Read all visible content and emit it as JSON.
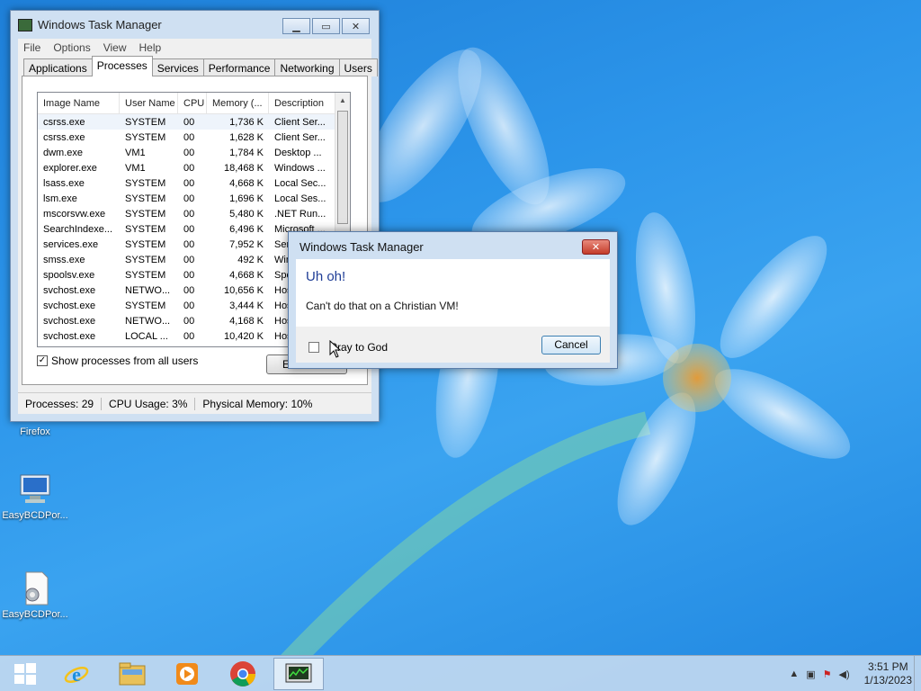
{
  "desktop": {
    "icons": [
      {
        "label": "Firefox"
      },
      {
        "label": "EasyBCDPor..."
      },
      {
        "label": "EasyBCDPor..."
      }
    ]
  },
  "task_manager": {
    "title": "Windows Task Manager",
    "menu": [
      "File",
      "Options",
      "View",
      "Help"
    ],
    "tabs": [
      "Applications",
      "Processes",
      "Services",
      "Performance",
      "Networking",
      "Users"
    ],
    "active_tab": "Processes",
    "columns": [
      "Image Name",
      "User Name",
      "CPU",
      "Memory (...",
      "Description"
    ],
    "rows": [
      [
        "csrss.exe",
        "SYSTEM",
        "00",
        "1,736 K",
        "Client Ser..."
      ],
      [
        "csrss.exe",
        "SYSTEM",
        "00",
        "1,628 K",
        "Client Ser..."
      ],
      [
        "dwm.exe",
        "VM1",
        "00",
        "1,784 K",
        "Desktop ..."
      ],
      [
        "explorer.exe",
        "VM1",
        "00",
        "18,468 K",
        "Windows ..."
      ],
      [
        "lsass.exe",
        "SYSTEM",
        "00",
        "4,668 K",
        "Local Sec..."
      ],
      [
        "lsm.exe",
        "SYSTEM",
        "00",
        "1,696 K",
        "Local Ses..."
      ],
      [
        "mscorsvw.exe",
        "SYSTEM",
        "00",
        "5,480 K",
        ".NET Run..."
      ],
      [
        "SearchIndexe...",
        "SYSTEM",
        "00",
        "6,496 K",
        "Microsoft ..."
      ],
      [
        "services.exe",
        "SYSTEM",
        "00",
        "7,952 K",
        "Ser..."
      ],
      [
        "smss.exe",
        "SYSTEM",
        "00",
        "492 K",
        "Win..."
      ],
      [
        "spoolsv.exe",
        "SYSTEM",
        "00",
        "4,668 K",
        "Spo..."
      ],
      [
        "svchost.exe",
        "NETWO...",
        "00",
        "10,656 K",
        "Hos..."
      ],
      [
        "svchost.exe",
        "SYSTEM",
        "00",
        "3,444 K",
        "Hos..."
      ],
      [
        "svchost.exe",
        "NETWO...",
        "00",
        "4,168 K",
        "Hos..."
      ],
      [
        "svchost.exe",
        "LOCAL ...",
        "00",
        "10,420 K",
        "Hos..."
      ]
    ],
    "show_all_label": "Show processes from all users",
    "show_all_checked": true,
    "end_process_label": "E...",
    "status": {
      "processes": "Processes: 29",
      "cpu": "CPU Usage: 3%",
      "memory": "Physical Memory: 10%"
    }
  },
  "dialog": {
    "title": "Windows Task Manager",
    "heading": "Uh oh!",
    "message": "Can't do that on a Christian VM!",
    "checkbox_label": "Pray to God",
    "cancel_label": "Cancel"
  },
  "taskbar": {
    "apps": [
      "start",
      "internet-explorer",
      "file-explorer",
      "media-player",
      "chrome",
      "task-manager"
    ],
    "active_app": "task-manager",
    "clock_time": "3:51 PM",
    "clock_date": "1/13/2023"
  },
  "colors": {
    "dialog_heading": "#1f3d96",
    "close_button": "#c43c2a",
    "desktop_blue": "#2c95ea"
  }
}
